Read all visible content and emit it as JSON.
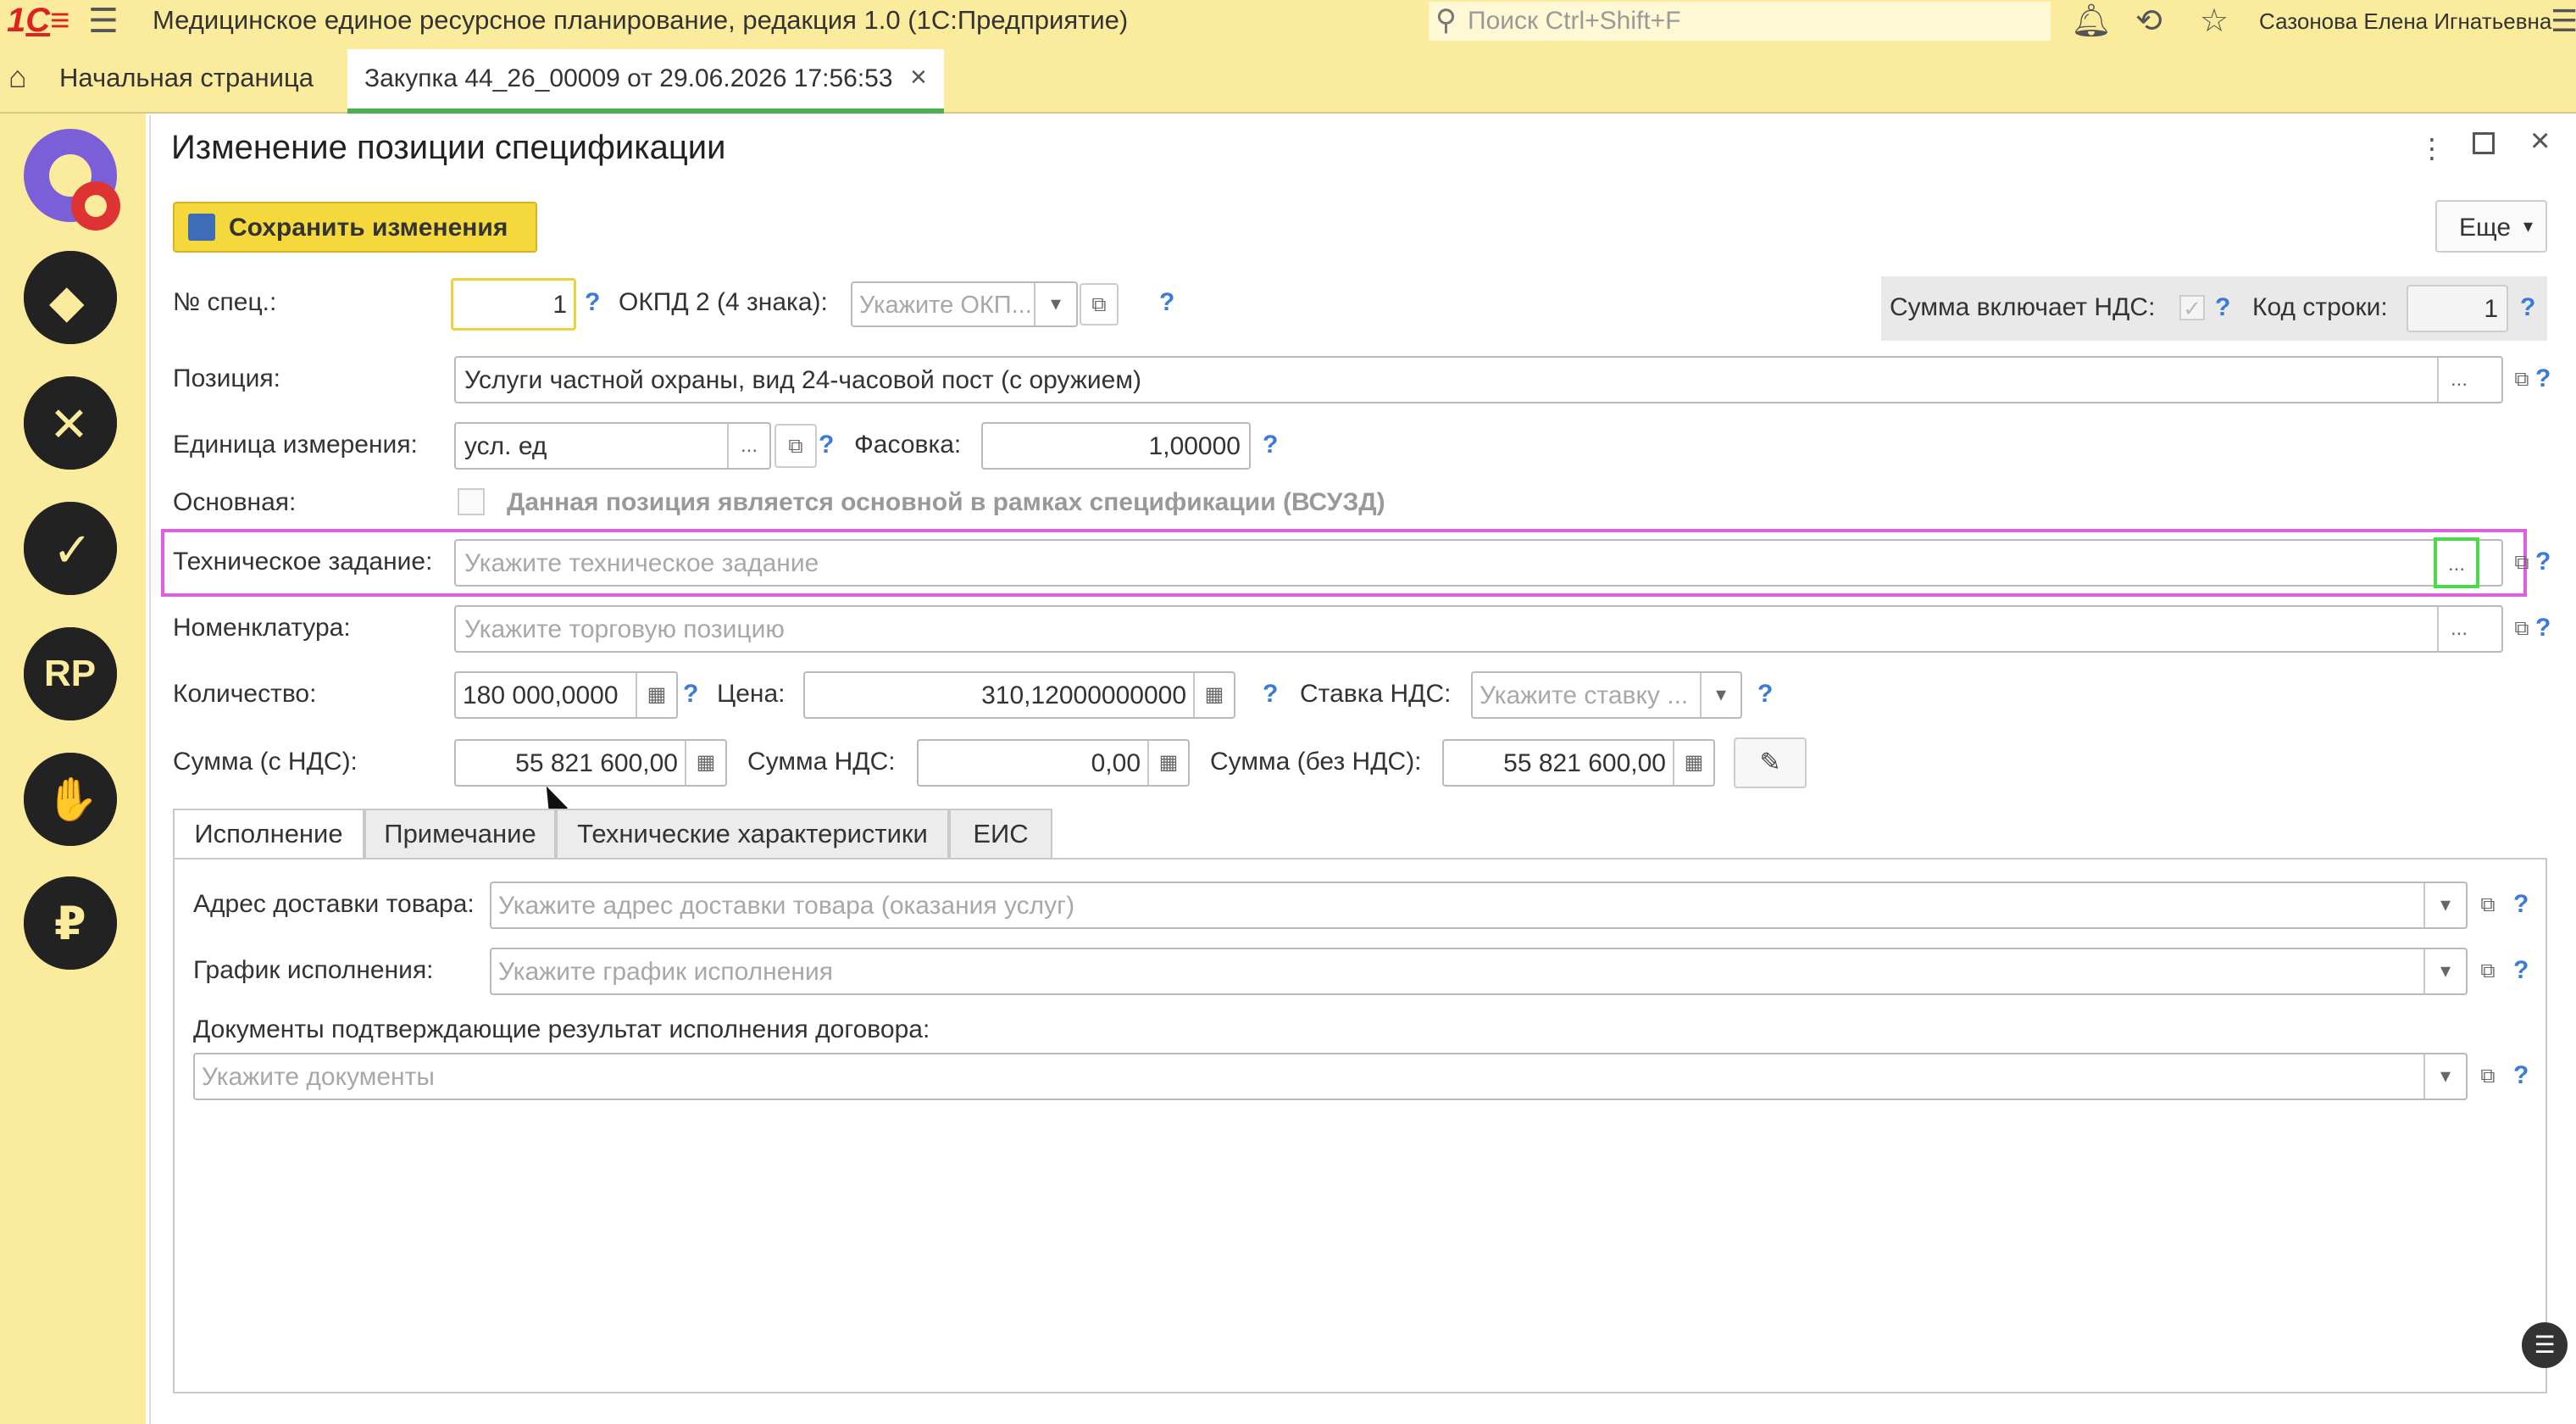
{
  "app": {
    "title": "Медицинское единое ресурсное планирование, редакция 1.0  (1С:Предприятие)",
    "search_placeholder": "Поиск Ctrl+Shift+F",
    "user": "Сазонова Елена Игнатьевна"
  },
  "tabs": {
    "home": "Начальная страница",
    "doc": "Закупка 44_26_00009 от 29.06.2026 17:56:53"
  },
  "sidebar_icons": [
    "settings-gear-icon",
    "diamond-gear-icon",
    "tools-gear-icon",
    "checklist-gear-icon",
    "rp-gear-icon",
    "handshake-gear-icon",
    "ruble-gear-icon"
  ],
  "sidebar_rp_label": "RP",
  "sidebar_ruble_label": "₽",
  "form": {
    "title": "Изменение позиции спецификации",
    "save_label": "Сохранить изменения",
    "more_label": "Еще",
    "spec_no_label": "№ спец.:",
    "spec_no_value": "1",
    "okpd_label": "ОКПД 2 (4 знака):",
    "okpd_placeholder": "Укажите ОКП...",
    "vat_included_label": "Сумма включает НДС:",
    "row_code_label": "Код строки:",
    "row_code_value": "1",
    "position_label": "Позиция:",
    "position_value": "Услуги частной охраны, вид 24-часовой пост (с оружием)",
    "unit_label": "Единица измерения:",
    "unit_value": "усл. ед",
    "packing_label": "Фасовка:",
    "packing_value": "1,00000",
    "main_label": "Основная:",
    "main_checkbox_text": "Данная позиция является основной в рамках спецификации (ВСУЗД)",
    "tech_task_label": "Техническое задание:",
    "tech_task_placeholder": "Укажите техническое задание",
    "nomenclature_label": "Номенклатура:",
    "nomenclature_placeholder": "Укажите торговую позицию",
    "qty_label": "Количество:",
    "qty_value": "180 000,0000",
    "price_label": "Цена:",
    "price_value": "310,12000000000",
    "vat_rate_label": "Ставка НДС:",
    "vat_rate_placeholder": "Укажите ставку ...",
    "sum_with_vat_label": "Сумма (с НДС):",
    "sum_with_vat_value": "55 821 600,00",
    "vat_sum_label": "Сумма НДС:",
    "vat_sum_value": "0,00",
    "sum_without_vat_label": "Сумма (без НДС):",
    "sum_without_vat_value": "55 821 600,00",
    "inner_tabs": [
      "Исполнение",
      "Примечание",
      "Технические характеристики",
      "ЕИС"
    ],
    "delivery_label": "Адрес доставки товара:",
    "delivery_placeholder": "Укажите адрес доставки товара (оказания услуг)",
    "schedule_label": "График исполнения:",
    "schedule_placeholder": "Укажите график исполнения",
    "docs_label": "Документы подтверждающие результат исполнения договора:",
    "docs_placeholder": "Укажите документы",
    "help": "?",
    "ellipsis": "...",
    "dropdown": "▾",
    "open": "⧉"
  }
}
